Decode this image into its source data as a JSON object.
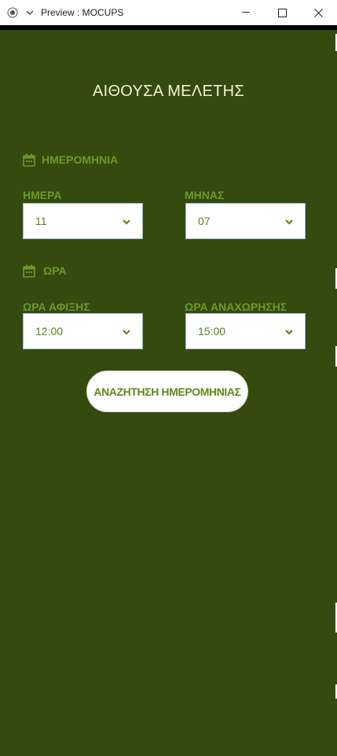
{
  "window": {
    "title": "Preview : MOCUPS"
  },
  "page": {
    "title": "ΑΙΘΟΥΣΑ ΜΕΛΕΤΗΣ"
  },
  "date_section": {
    "label": "ΗΜΕΡΟΜΗΝΙΑ",
    "icon": "calendar-icon",
    "day": {
      "label": "ΗΜΕΡΑ",
      "value": "11"
    },
    "month": {
      "label": "ΜΗΝΑΣ",
      "value": "07"
    }
  },
  "time_section": {
    "label": "ΩΡΑ",
    "icon": "calendar-icon",
    "arrival": {
      "label": "ΩΡΑ ΑΦΙΞΗΣ",
      "value": "12:00"
    },
    "departure": {
      "label": "ΩΡΑ ΑΝΑΧΩΡΗΣΗΣ",
      "value": "15:00"
    }
  },
  "actions": {
    "search_label": "ΑΝΑΖΗΤΗΣΗ ΗΜΕΡΟΜΗΝΙΑΣ"
  },
  "colors": {
    "background": "#344a0e",
    "accent": "#6e9a22",
    "title_text": "#f2f2d0",
    "field_text": "#5b7f1d"
  }
}
